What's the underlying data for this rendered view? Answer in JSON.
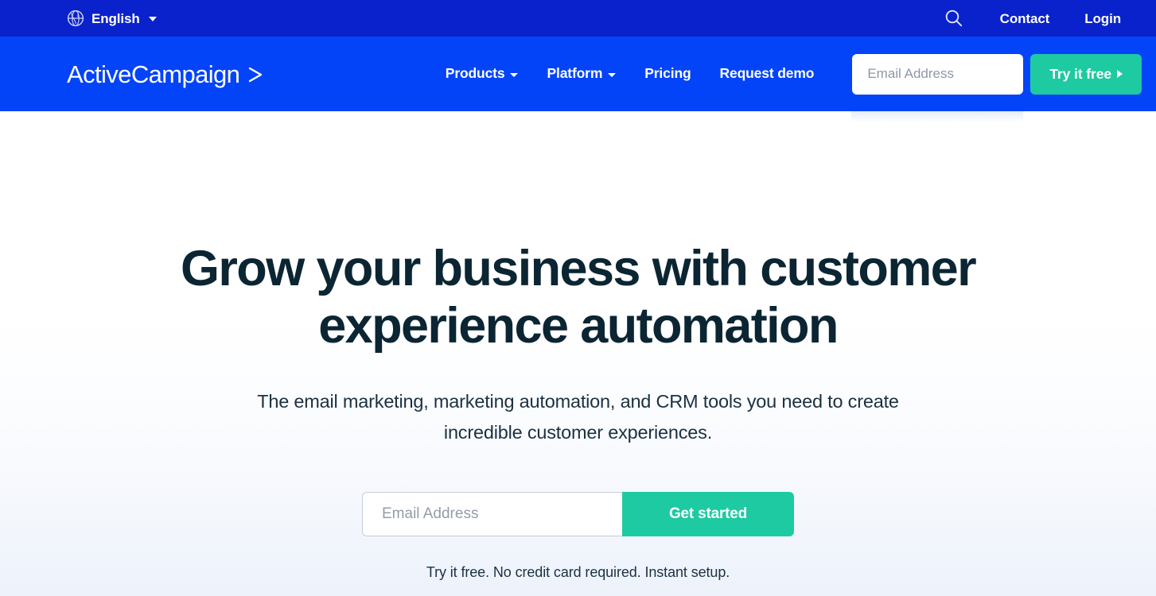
{
  "topbar": {
    "language": {
      "icon": "globe-icon",
      "label": "English",
      "caret": "chevron-down-icon"
    },
    "search_icon": "search-icon",
    "links": [
      {
        "label": "Contact"
      },
      {
        "label": "Login"
      }
    ]
  },
  "nav": {
    "logo": {
      "text": "ActiveCampaign",
      "mark": "chevron-right-logo-icon"
    },
    "items": [
      {
        "label": "Products",
        "has_dropdown": true
      },
      {
        "label": "Platform",
        "has_dropdown": true
      },
      {
        "label": "Pricing",
        "has_dropdown": false
      },
      {
        "label": "Request demo",
        "has_dropdown": false
      }
    ],
    "email_placeholder": "Email Address",
    "email_value": "",
    "cta_label": "Try it free"
  },
  "hero": {
    "title": "Grow your business with customer experience automation",
    "subtitle": "The email marketing, marketing automation, and CRM tools you need to create incredible customer experiences.",
    "email_placeholder": "Email Address",
    "email_value": "",
    "submit_label": "Get started",
    "note": "Try it free. No credit card required. Instant setup."
  },
  "colors": {
    "topbar_blue": "#0a22cc",
    "nav_blue": "#0444f8",
    "accent_green": "#1ecaa1",
    "heading_navy": "#0b2533",
    "hero_bottom": "#edf2fb"
  }
}
